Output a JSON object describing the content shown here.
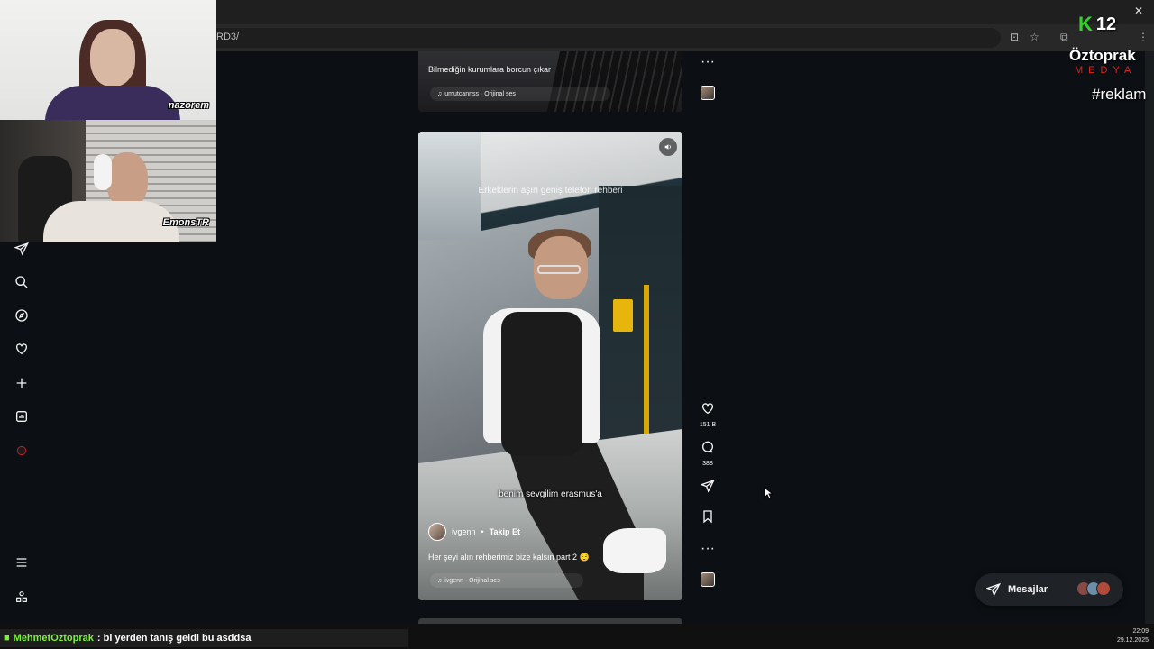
{
  "browser": {
    "url": "RD3/",
    "window_controls": [
      "–",
      "❐",
      "✕"
    ]
  },
  "sidebar": {
    "items": [
      {
        "name": "share-icon"
      },
      {
        "name": "search-icon"
      },
      {
        "name": "explore-icon"
      },
      {
        "name": "notifications-icon"
      },
      {
        "name": "create-icon"
      },
      {
        "name": "insights-icon"
      },
      {
        "name": "profile-icon"
      },
      {
        "name": "menu-icon"
      },
      {
        "name": "more-apps-icon"
      }
    ]
  },
  "prev_reel": {
    "caption": "Bilmediğin kurumlara borcun çıkar",
    "audio": "umutcannss · Orijinal ses"
  },
  "reel": {
    "overlay_top": "Erkeklerin aşırı geniş telefon rehberi",
    "subtitle": "benim sevgilim erasmus'a",
    "author": "ivgenn",
    "separator": "•",
    "follow_label": "Takip Et",
    "caption": "Her şeyi alın rehberimiz bize kalsın part 2 😌",
    "audio": "ivgenn · Orijinal ses"
  },
  "actions": {
    "likes": "151 B",
    "comments": "388"
  },
  "messages": {
    "label": "Mesajlar",
    "avatar_colors": [
      "#8a4a44",
      "#6b8fa8",
      "#b04a3a"
    ]
  },
  "overlay": {
    "cam1_name": "nazorem",
    "cam2_name": "EmonsTR",
    "k_number": "12",
    "brand": "Öztoprak",
    "brand_sub": "MEDYA",
    "hashtag": "#reklam"
  },
  "chat": {
    "user": "MehmetOztoprak",
    "message": ": bi yerden tanış geldi bu asddsa"
  },
  "clock": {
    "time": "22:09",
    "date": "29.12.2025"
  }
}
